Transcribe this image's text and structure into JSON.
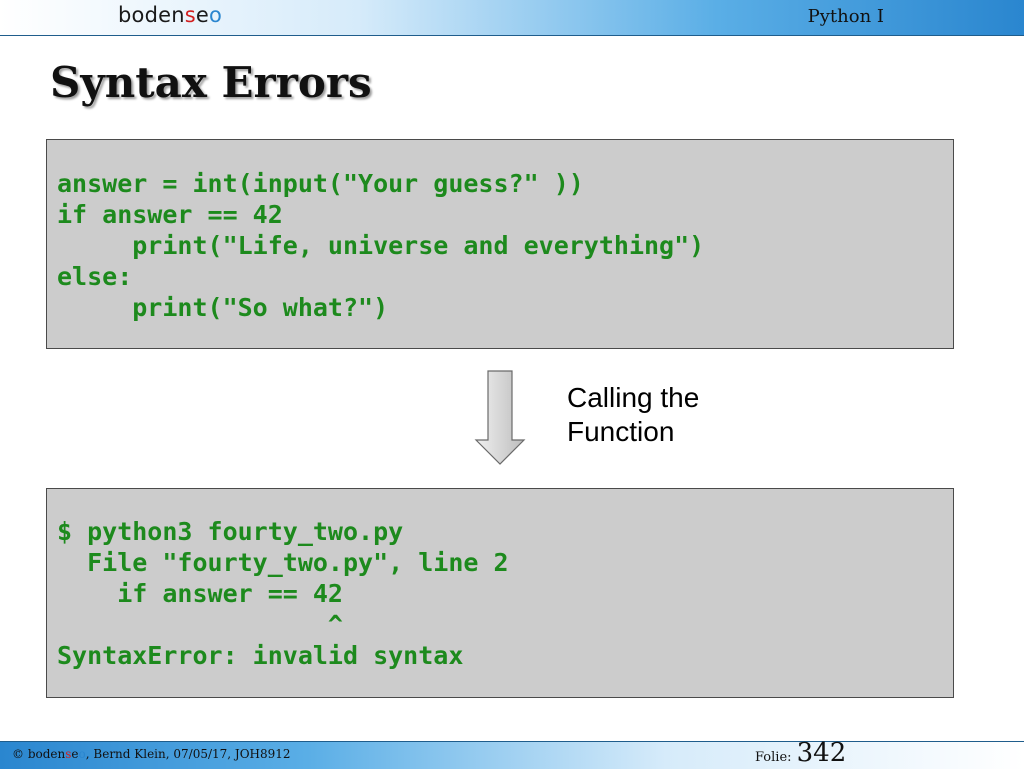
{
  "header": {
    "logo": {
      "part1": "boden",
      "s": "s",
      "e": "e",
      "o": "o"
    },
    "course": "Python I"
  },
  "slide": {
    "title": "Syntax Errors",
    "code_lines": [
      "answer = int(input(\"Your guess?\" ))",
      "if answer == 42",
      "     print(\"Life, universe and everything\")",
      "else:",
      "     print(\"So what?\")"
    ],
    "arrow_label_lines": [
      "Calling the",
      "Function"
    ],
    "output_lines": [
      "$ python3 fourty_two.py",
      "  File \"fourty_two.py\", line 2",
      "    if answer == 42",
      "                  ^",
      "SyntaxError: invalid syntax"
    ]
  },
  "footer": {
    "copyright": "©",
    "brand_part1": "boden",
    "brand_s": "s",
    "brand_e": "e",
    "brand_o": "o",
    "rest": ", Bernd Klein, 07/05/17, JOH8912",
    "folie_label": "Folie:",
    "folie_number": "342"
  },
  "colors": {
    "code_text": "#1d8a1d",
    "code_background": "#cccccc",
    "bar_blue": "#2a86cf",
    "logo_red": "#d21f1f"
  }
}
